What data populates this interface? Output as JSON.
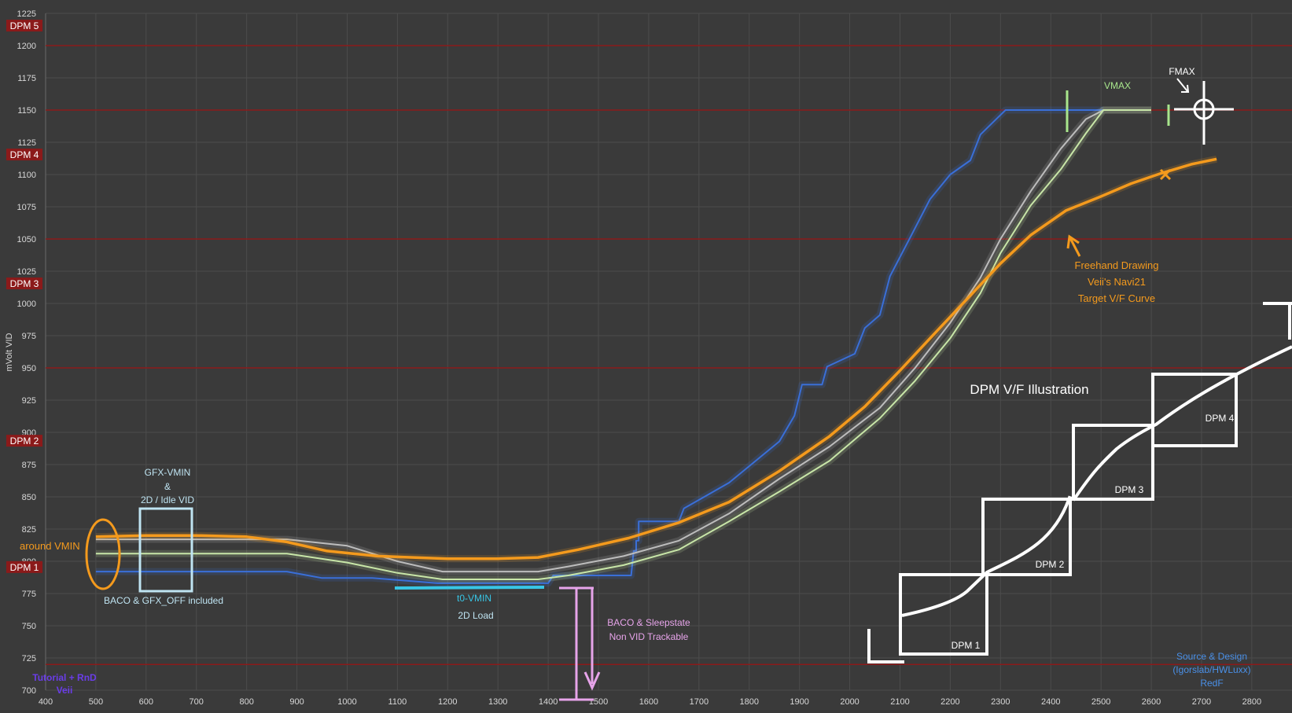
{
  "chart_data": {
    "type": "line",
    "xlabel": "",
    "ylabel": "mVolt VID",
    "xlim": [
      400,
      2880
    ],
    "ylim": [
      700,
      1225
    ],
    "xticks": [
      400,
      500,
      600,
      700,
      800,
      900,
      1000,
      1100,
      1200,
      1300,
      1400,
      1500,
      1600,
      1700,
      1800,
      1900,
      2000,
      2100,
      2200,
      2300,
      2400,
      2500,
      2600,
      2700,
      2800
    ],
    "yticks": [
      700,
      725,
      750,
      775,
      800,
      825,
      850,
      875,
      900,
      925,
      950,
      975,
      1000,
      1025,
      1050,
      1075,
      1100,
      1125,
      1150,
      1175,
      1200,
      1225
    ],
    "dpm_levels": [
      {
        "label": "DPM 5",
        "mv": 1200,
        "text_y": 1214
      },
      {
        "label": "DPM 4",
        "mv": 1150,
        "text_y": 1114
      },
      {
        "label": "DPM 3",
        "mv": 1050,
        "text_y": 1014
      },
      {
        "label": "DPM 2",
        "mv": 950,
        "text_y": 892
      },
      {
        "label": "DPM 1",
        "mv": 720,
        "text_y": 794
      }
    ],
    "series": [
      {
        "color": "#3a6fd8",
        "values": [
          [
            500,
            792
          ],
          [
            700,
            792
          ],
          [
            880,
            792
          ],
          [
            950,
            787
          ],
          [
            1050,
            787
          ],
          [
            1180,
            783
          ],
          [
            1330,
            783
          ],
          [
            1400,
            783
          ],
          [
            1410,
            789
          ],
          [
            1500,
            789
          ],
          [
            1565,
            789
          ],
          [
            1570,
            808
          ],
          [
            1575,
            808
          ],
          [
            1575,
            816
          ],
          [
            1580,
            816
          ],
          [
            1580,
            831
          ],
          [
            1660,
            831
          ],
          [
            1670,
            841
          ],
          [
            1760,
            861
          ],
          [
            1860,
            893
          ],
          [
            1890,
            913
          ],
          [
            1905,
            937
          ],
          [
            1945,
            937
          ],
          [
            1955,
            951
          ],
          [
            2010,
            961
          ],
          [
            2030,
            981
          ],
          [
            2060,
            991
          ],
          [
            2080,
            1021
          ],
          [
            2120,
            1051
          ],
          [
            2160,
            1081
          ],
          [
            2200,
            1100
          ],
          [
            2240,
            1111
          ],
          [
            2260,
            1131
          ],
          [
            2310,
            1150
          ],
          [
            2360,
            1150
          ],
          [
            2450,
            1150
          ],
          [
            2505,
            1150
          ]
        ]
      },
      {
        "color": "#bdbdbd",
        "values": [
          [
            500,
            817
          ],
          [
            700,
            817
          ],
          [
            880,
            817
          ],
          [
            1000,
            812
          ],
          [
            1100,
            800
          ],
          [
            1190,
            792
          ],
          [
            1270,
            792
          ],
          [
            1380,
            792
          ],
          [
            1440,
            796
          ],
          [
            1550,
            804
          ],
          [
            1660,
            816
          ],
          [
            1760,
            837
          ],
          [
            1860,
            864
          ],
          [
            1960,
            889
          ],
          [
            2060,
            919
          ],
          [
            2130,
            950
          ],
          [
            2200,
            985
          ],
          [
            2260,
            1020
          ],
          [
            2300,
            1050
          ],
          [
            2360,
            1087
          ],
          [
            2420,
            1120
          ],
          [
            2470,
            1143
          ],
          [
            2505,
            1150
          ],
          [
            2600,
            1150
          ]
        ]
      },
      {
        "color": "#c8e6a8",
        "values": [
          [
            500,
            806
          ],
          [
            700,
            806
          ],
          [
            880,
            806
          ],
          [
            1000,
            799
          ],
          [
            1100,
            791
          ],
          [
            1190,
            786
          ],
          [
            1270,
            786
          ],
          [
            1380,
            786
          ],
          [
            1440,
            789
          ],
          [
            1550,
            797
          ],
          [
            1660,
            809
          ],
          [
            1760,
            831
          ],
          [
            1860,
            854
          ],
          [
            1960,
            878
          ],
          [
            2060,
            911
          ],
          [
            2130,
            940
          ],
          [
            2200,
            973
          ],
          [
            2260,
            1008
          ],
          [
            2300,
            1039
          ],
          [
            2360,
            1076
          ],
          [
            2420,
            1104
          ],
          [
            2470,
            1132
          ],
          [
            2505,
            1150
          ],
          [
            2600,
            1150
          ]
        ]
      },
      {
        "color": "#f49a1d",
        "values": [
          [
            500,
            819
          ],
          [
            600,
            820
          ],
          [
            700,
            820
          ],
          [
            800,
            819
          ],
          [
            880,
            815
          ],
          [
            960,
            808
          ],
          [
            1060,
            804
          ],
          [
            1200,
            802
          ],
          [
            1300,
            802
          ],
          [
            1380,
            803
          ],
          [
            1460,
            809
          ],
          [
            1560,
            818
          ],
          [
            1660,
            830
          ],
          [
            1760,
            846
          ],
          [
            1860,
            870
          ],
          [
            1960,
            897
          ],
          [
            2030,
            920
          ],
          [
            2100,
            948
          ],
          [
            2160,
            973
          ],
          [
            2230,
            1002
          ],
          [
            2300,
            1031
          ],
          [
            2360,
            1053
          ],
          [
            2430,
            1072
          ],
          [
            2500,
            1083
          ],
          [
            2560,
            1093
          ],
          [
            2620,
            1101
          ],
          [
            2680,
            1108
          ],
          [
            2730,
            1112
          ]
        ]
      }
    ]
  },
  "annotations": {
    "around_vmin": "around VMIN",
    "gfx_vmin": [
      "GFX-VMIN",
      "&",
      "2D / Idle VID"
    ],
    "baco_gfx_off": "BACO & GFX_OFF included",
    "t0_vmin": "t0-VMIN",
    "load_2d": "2D Load",
    "baco_sleep": [
      "BACO & Sleepstate",
      "Non VID Trackable"
    ],
    "vmax": "VMAX",
    "fmax": "FMAX",
    "freehand": [
      "Freehand Drawing",
      "Veii's Navi21",
      "Target V/F Curve"
    ],
    "illustration_title": "DPM V/F Illustration",
    "illus_dpm1": "DPM 1",
    "illus_dpm2": "DPM 2",
    "illus_dpm3": "DPM 3",
    "illus_dpm4": "DPM 4",
    "tutorial": [
      "Tutorial + RnD",
      "Veii"
    ],
    "source": [
      "Source & Design",
      "(Igorslab/HWLuxx)",
      "RedF"
    ]
  },
  "colors": {
    "background": "#3a3a3a",
    "grid": "#4c4c4c",
    "dpm_line": "#8b1a1a",
    "orange": "#f49a1d",
    "cyan": "#38c6e6",
    "pink": "#e7a4ea",
    "white": "#ffffff",
    "blue_text": "#4a90e8",
    "purple_text": "#6a3de8",
    "light_blue_box": "#bfe4f2",
    "green_mark": "#a8e68c"
  }
}
